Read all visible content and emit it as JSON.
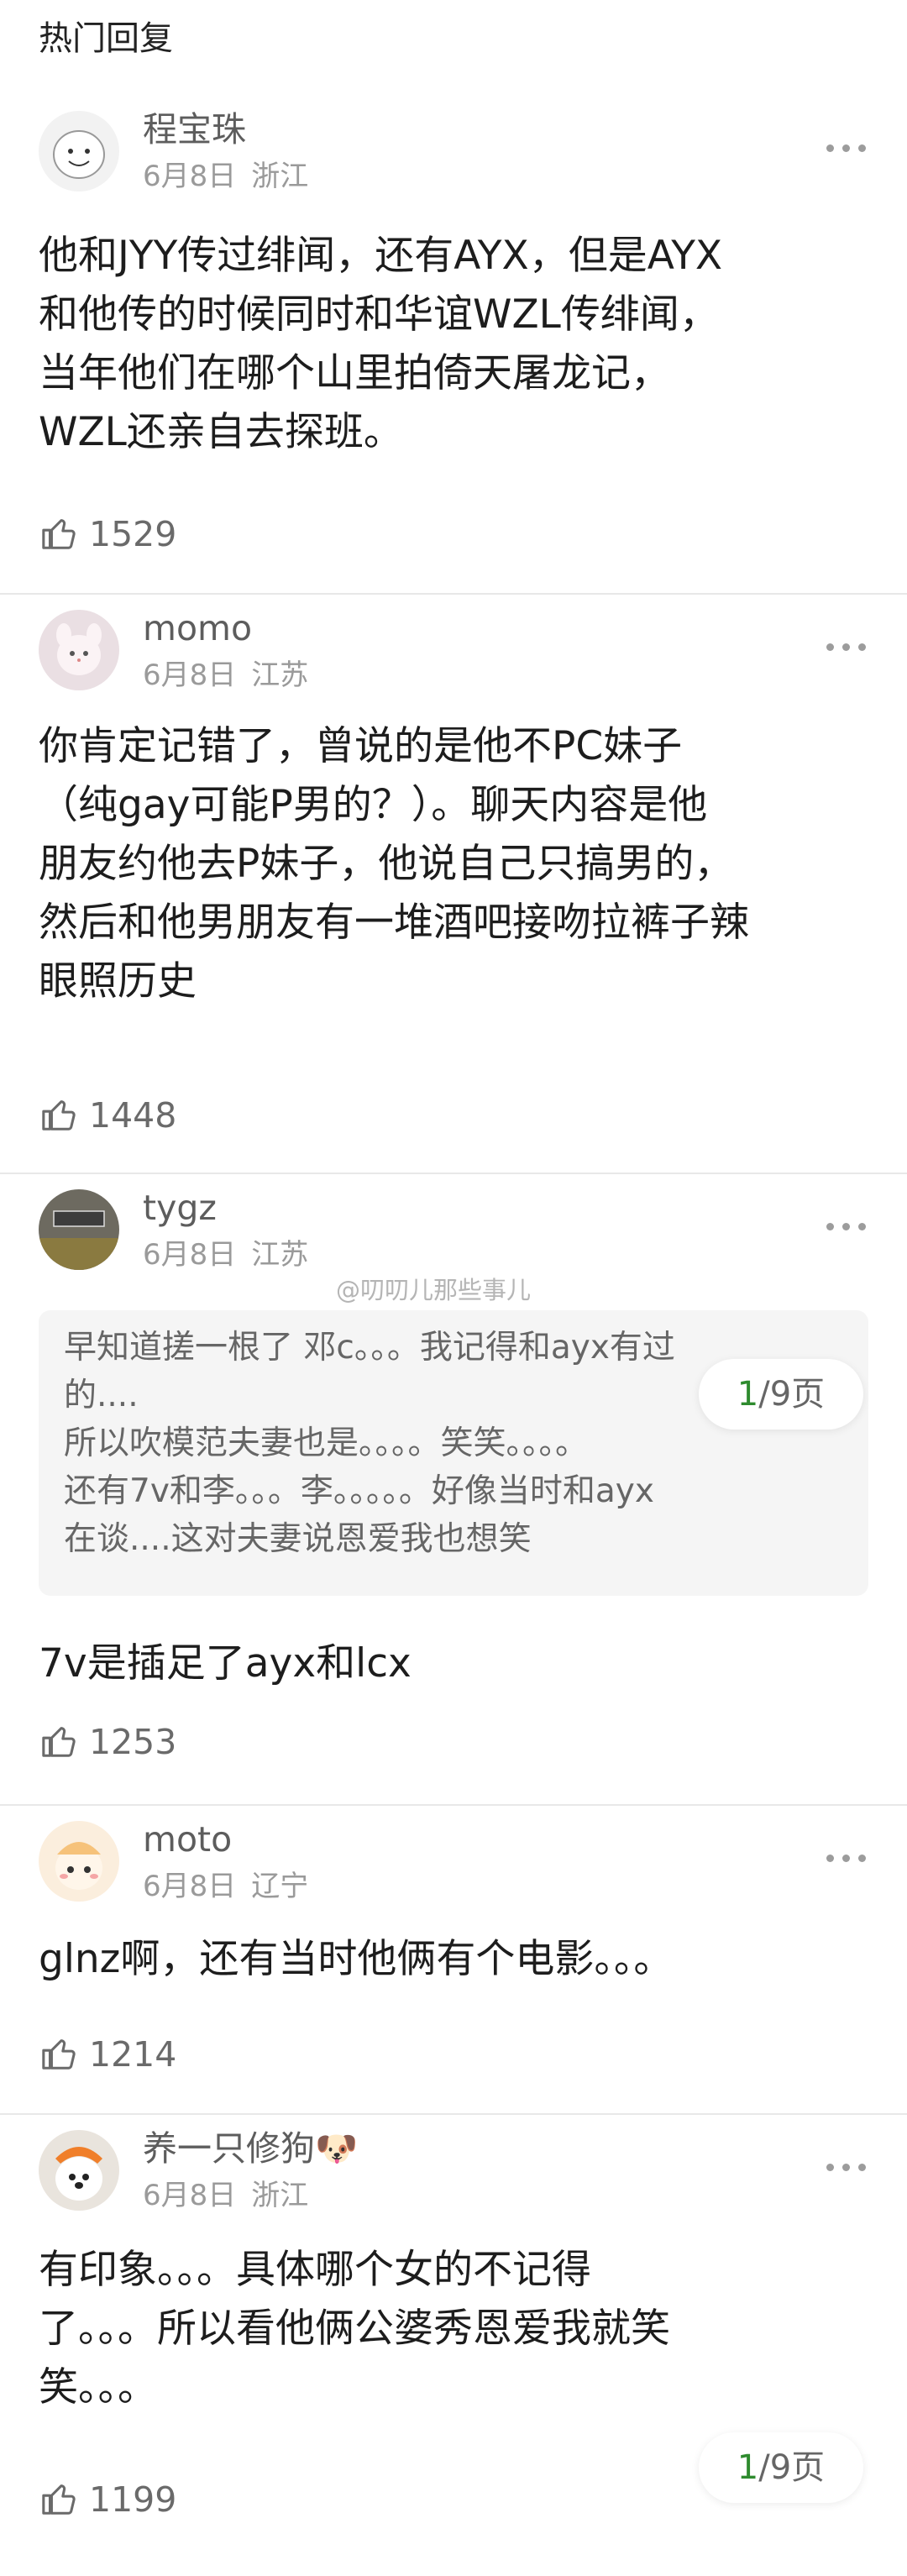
{
  "header": {
    "title": "热门回复"
  },
  "watermark": "@叨叨儿那些事儿",
  "pager": {
    "current": "1",
    "rest": "/9页"
  },
  "comments": [
    {
      "username": "程宝珠",
      "date": "6月8日",
      "location": "浙江",
      "text": "他和JYY传过绯闻，还有AYX，但是AYX\n和他传的时候同时和华谊WZL传绯闻，\n当年他们在哪个山里拍倚天屠龙记，\nWZL还亲自去探班。",
      "likes": "1529"
    },
    {
      "username": "momo",
      "date": "6月8日",
      "location": "江苏",
      "text": "你肯定记错了，曾说的是他不PC妹子\n（纯gay可能P男的？）。聊天内容是他\n朋友约他去P妹子，他说自己只搞男的，\n然后和他男朋友有一堆酒吧接吻拉裤子辣\n眼照历史",
      "likes": "1448"
    },
    {
      "username": "tygz",
      "date": "6月8日",
      "location": "江苏",
      "quote": "早知道搓一根了 邓c。。。我记得和ayx有过\n的....\n所以吹模范夫妻也是。。。。笑笑。。。。\n还有7v和李。。。李。。。。。好像当时和ayx\n在谈....这对夫妻说恩爱我也想笑",
      "text": "7v是插足了ayx和lcx",
      "likes": "1253"
    },
    {
      "username": "moto",
      "date": "6月8日",
      "location": "辽宁",
      "text": "glnz啊，还有当时他俩有个电影。。。",
      "likes": "1214"
    },
    {
      "username": "养一只修狗🐶",
      "date": "6月8日",
      "location": "浙江",
      "text": "有印象。。。具体哪个女的不记得\n了。。。所以看他俩公婆秀恩爱我就笑\n笑。。。",
      "likes": "1199"
    }
  ]
}
